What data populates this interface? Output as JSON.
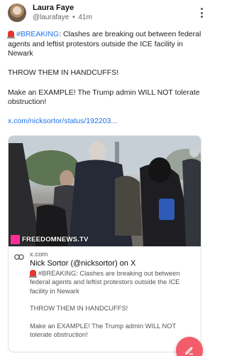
{
  "post": {
    "author_name": "Laura Faye",
    "handle": "@laurafaye",
    "separator": "•",
    "time": "41m",
    "hashtag": "#BREAKING",
    "line1_rest": ": Clashes are breaking out between federal agents and leftist protestors outside the ICE facility in Newark",
    "line2": "THROW THEM IN HANDCUFFS!",
    "line3": "Make an EXAMPLE! The Trump admin WILL NOT tolerate obstruction!",
    "link": "x.com/nicksortor/status/192203..."
  },
  "card": {
    "watermark": "FREEDOMNEWS.TV",
    "domain": "x.com",
    "title": "Nick Sortor (@nicksortor) on X",
    "desc1": "#BREAKING: Clashes are breaking out between federal agents and leftist protestors outside the ICE facility in Newark",
    "desc2": "THROW THEM IN HANDCUFFS!",
    "desc3": "Make an EXAMPLE! The Trump admin WILL NOT tolerate obstruction!"
  },
  "icons": {
    "more": "more-vertical-icon",
    "siren": "siren-emoji-icon",
    "link": "link-icon",
    "compose": "compose-pencil-icon"
  },
  "colors": {
    "link": "#1e73e8",
    "fab": "#f25c6b",
    "watermark_box": "#ff2f9a"
  }
}
